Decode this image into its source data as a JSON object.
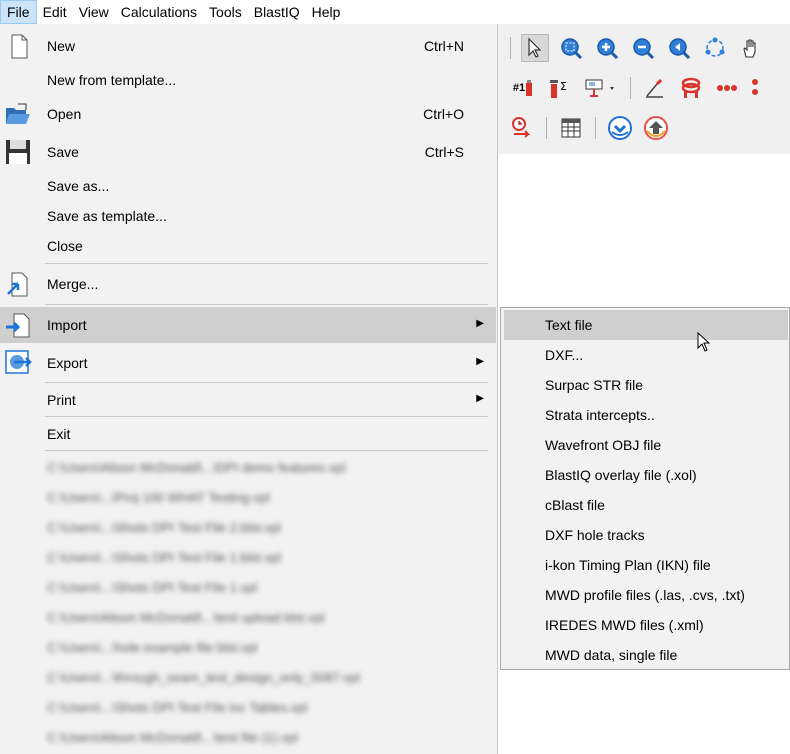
{
  "menubar": {
    "items": [
      "File",
      "Edit",
      "View",
      "Calculations",
      "Tools",
      "BlastIQ",
      "Help"
    ]
  },
  "file_menu": {
    "new_label": "New",
    "new_shortcut": "Ctrl+N",
    "new_from_template_label": "New from template...",
    "open_label": "Open",
    "open_shortcut": "Ctrl+O",
    "save_label": "Save",
    "save_shortcut": "Ctrl+S",
    "save_as_label": "Save as...",
    "save_as_template_label": "Save as template...",
    "close_label": "Close",
    "merge_label": "Merge...",
    "import_label": "Import",
    "export_label": "Export",
    "print_label": "Print",
    "exit_label": "Exit",
    "recent_files": [
      "C:\\Users\\Alison McDonald\\...\\DPI demo features.vpl",
      "C:\\Users\\...\\Proj 100 WHAT Testing.vpl",
      "C:\\Users\\...\\Shots DPI Test File 2.blst.vpl",
      "C:\\Users\\...\\Shots DPI Test File 1.blst.vpl",
      "C:\\Users\\...\\Shots DPI Test File 1.vpl",
      "C:\\Users\\Alison McDonald\\...\\test upload blst.vpl",
      "C:\\Users\\...\\hole example file blst.vpl",
      "C:\\Users\\...\\through_seam_test_design_only_0087.vpl",
      "C:\\Users\\...\\Shots DPI Test File inc Tables.vpl",
      "C:\\Users\\Alison McDonald\\...\\test file (1).vpl"
    ]
  },
  "import_submenu": {
    "items": [
      "Text file",
      "DXF...",
      "Surpac STR file",
      "Strata intercepts..",
      "Wavefront OBJ file",
      "BlastIQ overlay file (.xol)",
      "cBlast file",
      "DXF hole tracks",
      "i-kon Timing Plan (IKN) file",
      "MWD profile files (.las, .cvs, .txt)",
      "IREDES MWD files (.xml)",
      "MWD data, single file"
    ]
  },
  "toolbar": {
    "row2_label": "#1"
  },
  "colors": {
    "menu_bg": "#f2f2f2",
    "highlight": "#cfcfcf",
    "menubar_active": "#cce4f7",
    "toolbar_bg": "#f0f0f0",
    "icon_blue": "#1e74d6",
    "icon_red": "#d9342b"
  }
}
